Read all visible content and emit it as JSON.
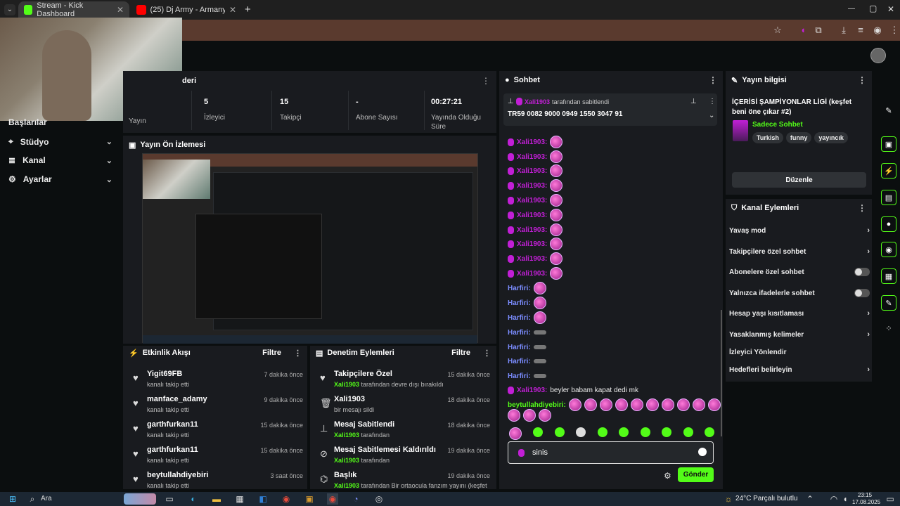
{
  "browser": {
    "tabs": [
      {
        "title": "Stream - Kick Dashboard",
        "close": "✕"
      },
      {
        "title": "(25) Dj Army - Armany (20",
        "close": "✕"
      }
    ],
    "new_tab": "+",
    "window_controls": {
      "minimize": "—",
      "maximize": "▢",
      "close": "✕"
    }
  },
  "sidebar": {
    "items": [
      {
        "label": "Başlarılar",
        "chev": ""
      },
      {
        "label": "Stüdyo",
        "chev": "⌄"
      },
      {
        "label": "Kanal",
        "chev": "⌄"
      },
      {
        "label": "Ayarlar",
        "chev": "⌄"
      }
    ]
  },
  "stats": {
    "header_partial": "deri",
    "items": [
      {
        "value": "5",
        "label": "İzleyici"
      },
      {
        "value": "15",
        "label": "Takipçi"
      },
      {
        "value": "-",
        "label": "Abone Sayısı"
      },
      {
        "value": "00:27:21",
        "label": "Yayında Olduğu Süre"
      }
    ],
    "partial_label": "Yayın"
  },
  "preview": {
    "title": "Yayın Ön İzlemesi"
  },
  "activity": {
    "title": "Etkinlik Akışı",
    "filter": "Filtre",
    "rows": [
      {
        "name": "Yigit69FB",
        "sub": "kanalı takip etti",
        "time": "7 dakika önce"
      },
      {
        "name": "manface_adamy",
        "sub": "kanalı takip etti",
        "time": "9 dakika önce"
      },
      {
        "name": "garthfurkan11",
        "sub": "kanalı takip etti",
        "time": "15 dakika önce"
      },
      {
        "name": "garthfurkan11",
        "sub": "kanalı takip etti",
        "time": "15 dakika önce"
      },
      {
        "name": "beytullahdiyebiri",
        "sub": "kanalı takip etti",
        "time": "3 saat önce"
      }
    ]
  },
  "moderation": {
    "title": "Denetim Eylemleri",
    "filter": "Filtre",
    "rows": [
      {
        "name": "Takipçilere Özel",
        "actor": "Xali1903",
        "sub": " tarafından devre dışı bırakıldı",
        "time": "15 dakika önce"
      },
      {
        "name": "Xali1903",
        "actor": "",
        "sub": "bir mesajı sildi",
        "time": "18 dakika önce"
      },
      {
        "name": "Mesaj Sabitlendi",
        "actor": "Xali1903",
        "sub": " tarafından",
        "time": "18 dakika önce"
      },
      {
        "name": "Mesaj Sabitlemesi Kaldırıldı",
        "actor": "Xali1903",
        "sub": " tarafından",
        "time": "19 dakika önce"
      },
      {
        "name": "Başlık",
        "actor": "Xali1903",
        "sub": " tarafından Bir ortaocula fanzım yayını (keşfet",
        "time": "19 dakika önce"
      }
    ]
  },
  "chat": {
    "title": "Sohbet",
    "pinned": {
      "user": "Xali1903",
      "by": " tarafından sabitlendi",
      "message": "TR59 0082 9000 0949 1550 3047 91"
    },
    "emote_lines": 10,
    "user_x": "Xali1903:",
    "user_h": "Harfiri:",
    "last_msg": {
      "user": "Xali1903:",
      "text": " beyler babam kapat dedi mk"
    },
    "emote_msg_user": "beytullahdiyebiri:",
    "input_value": "sinis",
    "send_label": "Gönder"
  },
  "stream_info": {
    "title": "Yayın bilgisi",
    "stream_title": "İÇERİSİ ŞAMPİYONLAR LİGİ (keşfet beni öne çıkar #2)",
    "category": "Sadece Sohbet",
    "tags": [
      "Turkish",
      "funny",
      "yayıncık"
    ],
    "edit_label": "Düzenle"
  },
  "channel_actions": {
    "title": "Kanal Eylemleri",
    "rows": [
      {
        "label": "Yavaş mod",
        "control": "chevron"
      },
      {
        "label": "Takipçilere özel sohbet",
        "control": "chevron"
      },
      {
        "label": "Abonelere özel sohbet",
        "control": "toggle"
      },
      {
        "label": "Yalnızca ifadelerle sohbet",
        "control": "toggle"
      },
      {
        "label": "Hesap yaşı kısıtlaması",
        "control": "chevron"
      },
      {
        "label": "Yasaklanmış kelimeler",
        "control": "chevron"
      },
      {
        "label": "İzleyici Yönlendir",
        "control": "none"
      },
      {
        "label": "Hedefleri belirleyin",
        "control": "chevron"
      }
    ]
  },
  "taskbar": {
    "search": "Ara",
    "weather": "24°C  Parçalı bulutlu",
    "time": "23:15",
    "date": "17.08.2025"
  },
  "colors": {
    "accent": "#53fc18",
    "brand_purple": "#c21fd6",
    "panel": "#191b1f",
    "page": "#0b0e0f"
  }
}
